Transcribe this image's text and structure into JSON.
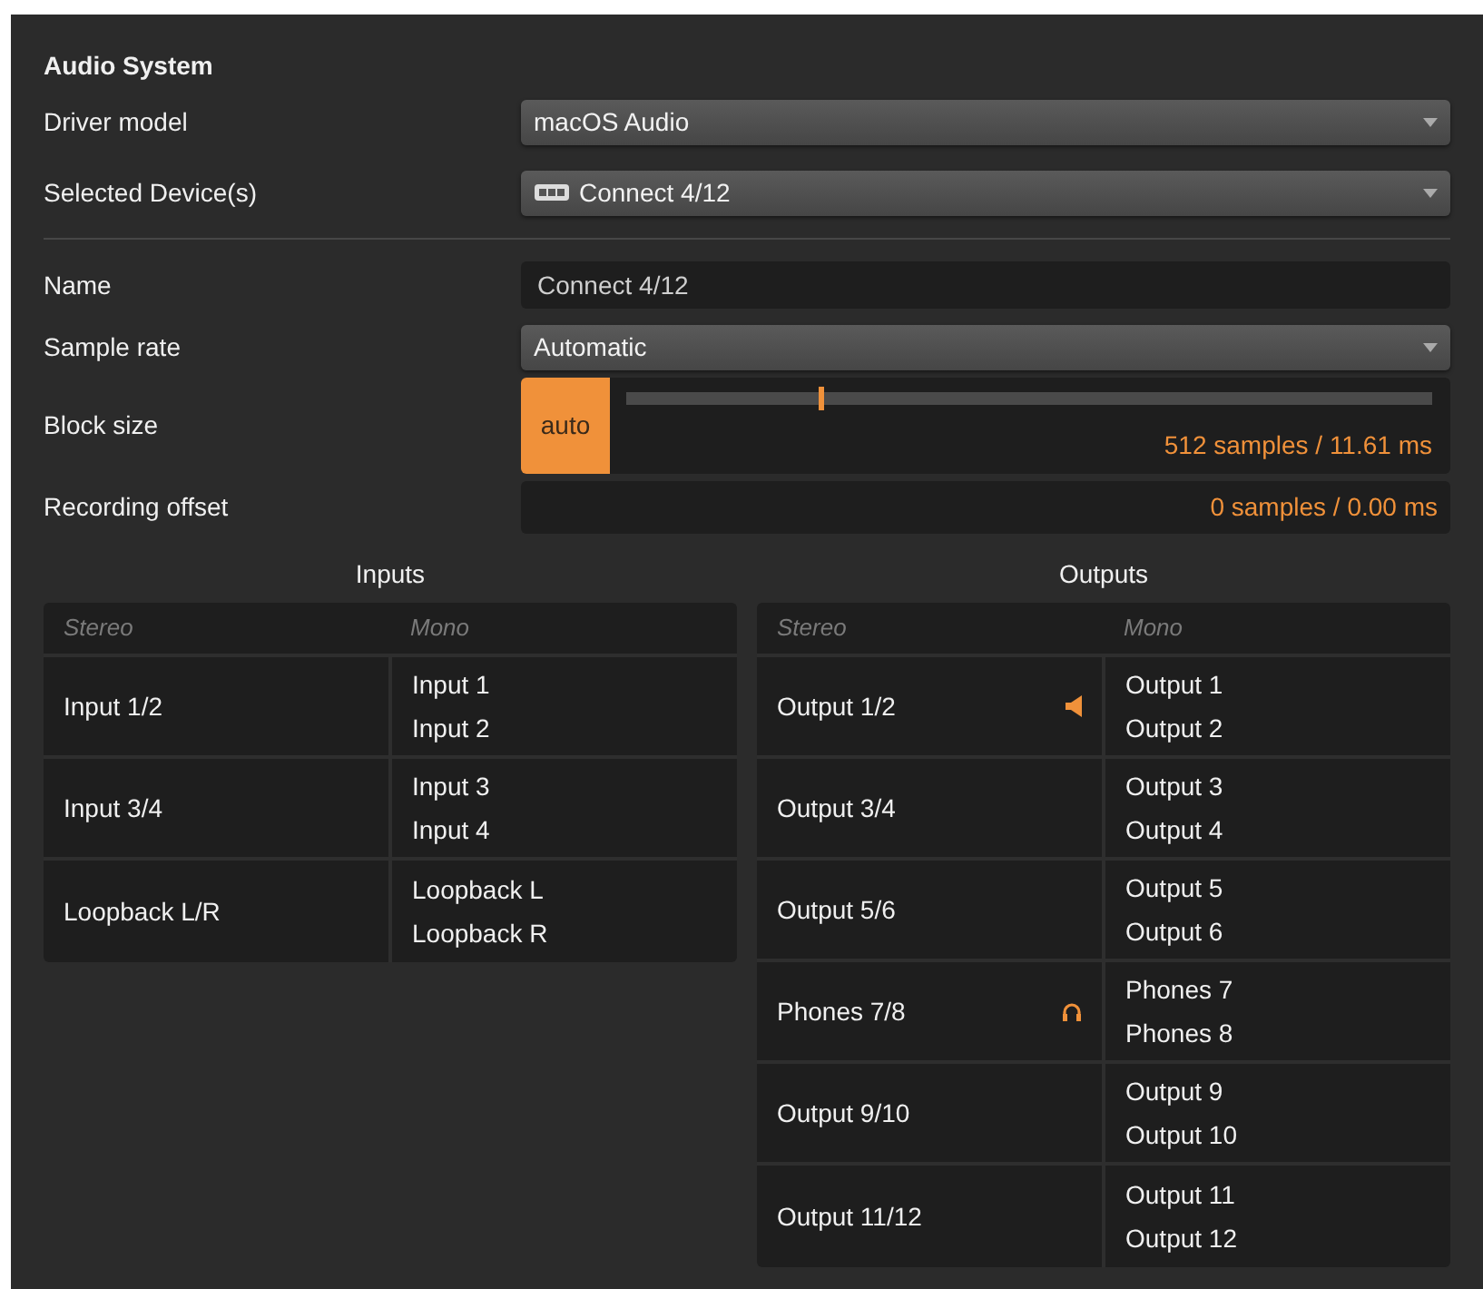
{
  "section_title": "Audio System",
  "driver_model": {
    "label": "Driver model",
    "value": "macOS Audio"
  },
  "selected_devices": {
    "label": "Selected Device(s)",
    "value": "Connect 4/12"
  },
  "name": {
    "label": "Name",
    "value": "Connect 4/12"
  },
  "sample_rate": {
    "label": "Sample rate",
    "value": "Automatic"
  },
  "block_size": {
    "label": "Block size",
    "auto_button": "auto",
    "auto_on": true,
    "level": 0.24,
    "reading": "512 samples / 11.61 ms"
  },
  "recording_offset": {
    "label": "Recording offset",
    "reading": "0 samples / 0.00 ms"
  },
  "inputs": {
    "title": "Inputs",
    "columns": [
      "Stereo",
      "Mono"
    ],
    "rows": [
      {
        "stereo": "Input 1/2",
        "mono": [
          "Input 1",
          "Input 2"
        ]
      },
      {
        "stereo": "Input 3/4",
        "mono": [
          "Input 3",
          "Input 4"
        ]
      },
      {
        "stereo": "Loopback L/R",
        "mono": [
          "Loopback L",
          "Loopback R"
        ]
      }
    ]
  },
  "outputs": {
    "title": "Outputs",
    "columns": [
      "Stereo",
      "Mono"
    ],
    "rows": [
      {
        "stereo": "Output 1/2",
        "kind": "speaker",
        "mono": [
          "Output 1",
          "Output 2"
        ]
      },
      {
        "stereo": "Output 3/4",
        "mono": [
          "Output 3",
          "Output 4"
        ]
      },
      {
        "stereo": "Output 5/6",
        "mono": [
          "Output 5",
          "Output 6"
        ]
      },
      {
        "stereo": "Phones 7/8",
        "kind": "headphones",
        "mono": [
          "Phones 7",
          "Phones 8"
        ]
      },
      {
        "stereo": "Output 9/10",
        "mono": [
          "Output 9",
          "Output 10"
        ]
      },
      {
        "stereo": "Output 11/12",
        "mono": [
          "Output 11",
          "Output 12"
        ]
      }
    ]
  }
}
